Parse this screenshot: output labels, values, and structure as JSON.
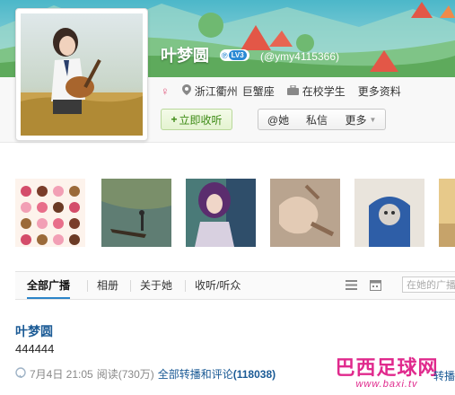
{
  "profile": {
    "name": "叶梦圆",
    "level": "LV3",
    "handle": "(@ymy4115366)",
    "location": "浙江衢州",
    "zodiac": "巨蟹座",
    "status": "在校学生",
    "more_info": "更多资料"
  },
  "actions": {
    "follow": "立即收听",
    "at_her": "@她",
    "private_msg": "私信",
    "more": "更多"
  },
  "tabs": [
    {
      "label": "全部广播"
    },
    {
      "label": "相册"
    },
    {
      "label": "关于她"
    },
    {
      "label": "收听/听众"
    }
  ],
  "search": {
    "placeholder": "在她的广播"
  },
  "post": {
    "author": "叶梦圆",
    "text": "444444",
    "date": "7月4日 21:05",
    "reads": "阅读(730万)",
    "comments_label": "全部转播和评论",
    "comments_count": "(118038)"
  },
  "watermark": {
    "title": "巴西足球网",
    "url": "www.baxi.tv",
    "overlay": "转播"
  },
  "icons": {
    "gender": "female-symbol",
    "location": "location-pin",
    "job": "briefcase",
    "view_list": "list-view",
    "view_calendar": "calendar-view"
  },
  "colors": {
    "accent_blue": "#2c84c8",
    "link_blue": "#1a5a95",
    "follow_green": "#3c8a14",
    "watermark_pink": "#e02a8d"
  }
}
